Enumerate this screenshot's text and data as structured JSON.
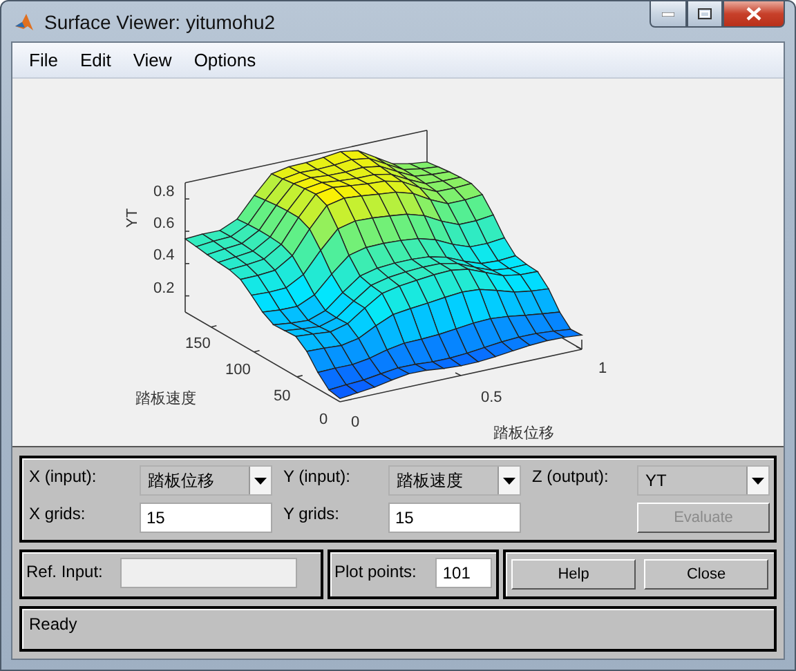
{
  "window": {
    "title": "Surface Viewer: yitumohu2"
  },
  "menu": [
    "File",
    "Edit",
    "View",
    "Options"
  ],
  "plot": {
    "xlabel": "踏板位移",
    "ylabel": "踏板速度",
    "zlabel": "YT",
    "xticks": [
      "0",
      "0.5",
      "1"
    ],
    "yticks": [
      "0",
      "50",
      "100",
      "150"
    ],
    "zticks": [
      "0.8",
      "0.6",
      "0.4",
      "0.2"
    ]
  },
  "controls": {
    "x_input": {
      "label": "X (input):",
      "value": "踏板位移"
    },
    "y_input": {
      "label": "Y (input):",
      "value": "踏板速度"
    },
    "z_output": {
      "label": "Z (output):",
      "value": "YT"
    },
    "x_grids": {
      "label": "X grids:",
      "value": "15"
    },
    "y_grids": {
      "label": "Y grids:",
      "value": "15"
    },
    "evaluate": {
      "label": "Evaluate",
      "disabled": true
    }
  },
  "ref_input": {
    "label": "Ref. Input:",
    "disabled": true
  },
  "plot_points": {
    "label": "Plot points:",
    "value": "101"
  },
  "buttons": [
    "Help",
    "Close"
  ],
  "status": "Ready"
}
